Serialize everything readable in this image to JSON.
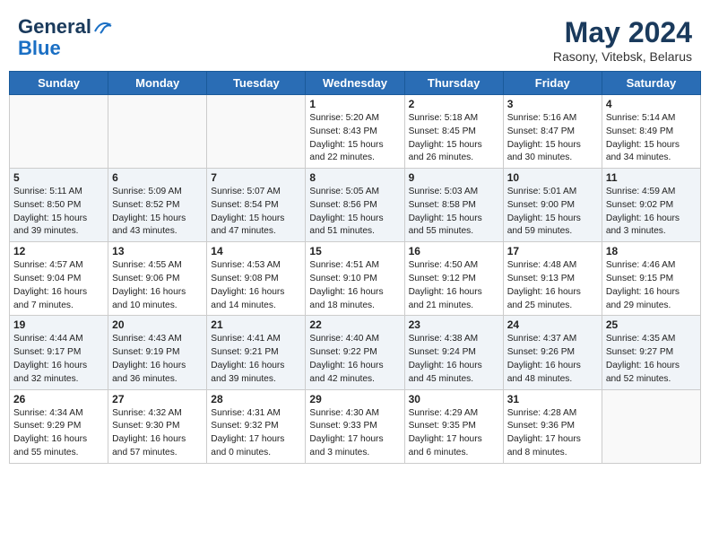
{
  "header": {
    "logo_line1": "General",
    "logo_line2": "Blue",
    "month_year": "May 2024",
    "location": "Rasony, Vitebsk, Belarus"
  },
  "weekdays": [
    "Sunday",
    "Monday",
    "Tuesday",
    "Wednesday",
    "Thursday",
    "Friday",
    "Saturday"
  ],
  "weeks": [
    [
      {
        "day": "",
        "sunrise": "",
        "sunset": "",
        "daylight": ""
      },
      {
        "day": "",
        "sunrise": "",
        "sunset": "",
        "daylight": ""
      },
      {
        "day": "",
        "sunrise": "",
        "sunset": "",
        "daylight": ""
      },
      {
        "day": "1",
        "sunrise": "Sunrise: 5:20 AM",
        "sunset": "Sunset: 8:43 PM",
        "daylight": "Daylight: 15 hours and 22 minutes."
      },
      {
        "day": "2",
        "sunrise": "Sunrise: 5:18 AM",
        "sunset": "Sunset: 8:45 PM",
        "daylight": "Daylight: 15 hours and 26 minutes."
      },
      {
        "day": "3",
        "sunrise": "Sunrise: 5:16 AM",
        "sunset": "Sunset: 8:47 PM",
        "daylight": "Daylight: 15 hours and 30 minutes."
      },
      {
        "day": "4",
        "sunrise": "Sunrise: 5:14 AM",
        "sunset": "Sunset: 8:49 PM",
        "daylight": "Daylight: 15 hours and 34 minutes."
      }
    ],
    [
      {
        "day": "5",
        "sunrise": "Sunrise: 5:11 AM",
        "sunset": "Sunset: 8:50 PM",
        "daylight": "Daylight: 15 hours and 39 minutes."
      },
      {
        "day": "6",
        "sunrise": "Sunrise: 5:09 AM",
        "sunset": "Sunset: 8:52 PM",
        "daylight": "Daylight: 15 hours and 43 minutes."
      },
      {
        "day": "7",
        "sunrise": "Sunrise: 5:07 AM",
        "sunset": "Sunset: 8:54 PM",
        "daylight": "Daylight: 15 hours and 47 minutes."
      },
      {
        "day": "8",
        "sunrise": "Sunrise: 5:05 AM",
        "sunset": "Sunset: 8:56 PM",
        "daylight": "Daylight: 15 hours and 51 minutes."
      },
      {
        "day": "9",
        "sunrise": "Sunrise: 5:03 AM",
        "sunset": "Sunset: 8:58 PM",
        "daylight": "Daylight: 15 hours and 55 minutes."
      },
      {
        "day": "10",
        "sunrise": "Sunrise: 5:01 AM",
        "sunset": "Sunset: 9:00 PM",
        "daylight": "Daylight: 15 hours and 59 minutes."
      },
      {
        "day": "11",
        "sunrise": "Sunrise: 4:59 AM",
        "sunset": "Sunset: 9:02 PM",
        "daylight": "Daylight: 16 hours and 3 minutes."
      }
    ],
    [
      {
        "day": "12",
        "sunrise": "Sunrise: 4:57 AM",
        "sunset": "Sunset: 9:04 PM",
        "daylight": "Daylight: 16 hours and 7 minutes."
      },
      {
        "day": "13",
        "sunrise": "Sunrise: 4:55 AM",
        "sunset": "Sunset: 9:06 PM",
        "daylight": "Daylight: 16 hours and 10 minutes."
      },
      {
        "day": "14",
        "sunrise": "Sunrise: 4:53 AM",
        "sunset": "Sunset: 9:08 PM",
        "daylight": "Daylight: 16 hours and 14 minutes."
      },
      {
        "day": "15",
        "sunrise": "Sunrise: 4:51 AM",
        "sunset": "Sunset: 9:10 PM",
        "daylight": "Daylight: 16 hours and 18 minutes."
      },
      {
        "day": "16",
        "sunrise": "Sunrise: 4:50 AM",
        "sunset": "Sunset: 9:12 PM",
        "daylight": "Daylight: 16 hours and 21 minutes."
      },
      {
        "day": "17",
        "sunrise": "Sunrise: 4:48 AM",
        "sunset": "Sunset: 9:13 PM",
        "daylight": "Daylight: 16 hours and 25 minutes."
      },
      {
        "day": "18",
        "sunrise": "Sunrise: 4:46 AM",
        "sunset": "Sunset: 9:15 PM",
        "daylight": "Daylight: 16 hours and 29 minutes."
      }
    ],
    [
      {
        "day": "19",
        "sunrise": "Sunrise: 4:44 AM",
        "sunset": "Sunset: 9:17 PM",
        "daylight": "Daylight: 16 hours and 32 minutes."
      },
      {
        "day": "20",
        "sunrise": "Sunrise: 4:43 AM",
        "sunset": "Sunset: 9:19 PM",
        "daylight": "Daylight: 16 hours and 36 minutes."
      },
      {
        "day": "21",
        "sunrise": "Sunrise: 4:41 AM",
        "sunset": "Sunset: 9:21 PM",
        "daylight": "Daylight: 16 hours and 39 minutes."
      },
      {
        "day": "22",
        "sunrise": "Sunrise: 4:40 AM",
        "sunset": "Sunset: 9:22 PM",
        "daylight": "Daylight: 16 hours and 42 minutes."
      },
      {
        "day": "23",
        "sunrise": "Sunrise: 4:38 AM",
        "sunset": "Sunset: 9:24 PM",
        "daylight": "Daylight: 16 hours and 45 minutes."
      },
      {
        "day": "24",
        "sunrise": "Sunrise: 4:37 AM",
        "sunset": "Sunset: 9:26 PM",
        "daylight": "Daylight: 16 hours and 48 minutes."
      },
      {
        "day": "25",
        "sunrise": "Sunrise: 4:35 AM",
        "sunset": "Sunset: 9:27 PM",
        "daylight": "Daylight: 16 hours and 52 minutes."
      }
    ],
    [
      {
        "day": "26",
        "sunrise": "Sunrise: 4:34 AM",
        "sunset": "Sunset: 9:29 PM",
        "daylight": "Daylight: 16 hours and 55 minutes."
      },
      {
        "day": "27",
        "sunrise": "Sunrise: 4:32 AM",
        "sunset": "Sunset: 9:30 PM",
        "daylight": "Daylight: 16 hours and 57 minutes."
      },
      {
        "day": "28",
        "sunrise": "Sunrise: 4:31 AM",
        "sunset": "Sunset: 9:32 PM",
        "daylight": "Daylight: 17 hours and 0 minutes."
      },
      {
        "day": "29",
        "sunrise": "Sunrise: 4:30 AM",
        "sunset": "Sunset: 9:33 PM",
        "daylight": "Daylight: 17 hours and 3 minutes."
      },
      {
        "day": "30",
        "sunrise": "Sunrise: 4:29 AM",
        "sunset": "Sunset: 9:35 PM",
        "daylight": "Daylight: 17 hours and 6 minutes."
      },
      {
        "day": "31",
        "sunrise": "Sunrise: 4:28 AM",
        "sunset": "Sunset: 9:36 PM",
        "daylight": "Daylight: 17 hours and 8 minutes."
      },
      {
        "day": "",
        "sunrise": "",
        "sunset": "",
        "daylight": ""
      }
    ]
  ]
}
